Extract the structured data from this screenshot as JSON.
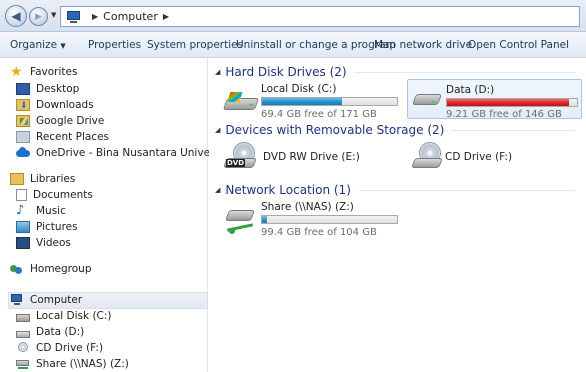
{
  "address": {
    "breadcrumb": "Computer"
  },
  "commands": {
    "organize": "Organize",
    "properties": "Properties",
    "system_properties": "System properties",
    "uninstall": "Uninstall or change a program",
    "map_drive": "Map network drive",
    "control_panel": "Open Control Panel"
  },
  "nav": {
    "favorites": "Favorites",
    "desktop": "Desktop",
    "downloads": "Downloads",
    "google_drive": "Google Drive",
    "recent_places": "Recent Places",
    "onedrive": "OneDrive - Bina Nusantara University",
    "libraries": "Libraries",
    "documents": "Documents",
    "music": "Music",
    "pictures": "Pictures",
    "videos": "Videos",
    "homegroup": "Homegroup",
    "computer": "Computer",
    "local_disk": "Local Disk (C:)",
    "data": "Data (D:)",
    "cd_drive": "CD Drive (F:)",
    "share": "Share (\\\\NAS) (Z:)"
  },
  "groups": {
    "hdd": "Hard Disk Drives (2)",
    "removable": "Devices with Removable Storage (2)",
    "network": "Network Location (1)"
  },
  "drives": {
    "c": {
      "name": "Local Disk (C:)",
      "free": "69.4 GB free of 171 GB",
      "used_fraction": 0.59
    },
    "d": {
      "name": "Data (D:)",
      "free": "9.21 GB free of 146 GB",
      "used_fraction": 0.94
    },
    "e": {
      "name": "DVD RW Drive (E:)",
      "icon_text": "DVD"
    },
    "f": {
      "name": "CD Drive (F:)"
    },
    "z": {
      "name": "Share (\\\\NAS) (Z:)",
      "free": "99.4 GB free of 104 GB",
      "used_fraction": 0.04
    }
  },
  "colors": {
    "accent_blue": "#2a8fca",
    "alert_red": "#da2525",
    "group_header": "#1e3287"
  }
}
